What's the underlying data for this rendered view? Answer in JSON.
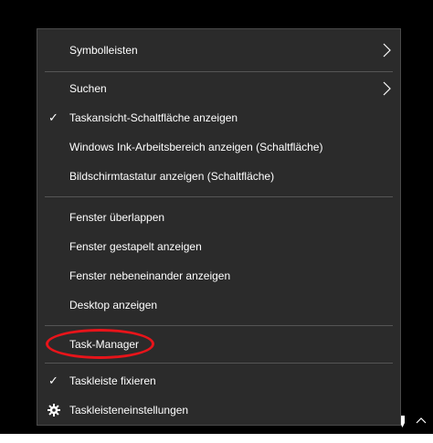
{
  "context_menu": {
    "items": {
      "toolbars": {
        "label": "Symbolleisten",
        "checked": false,
        "submenu": true
      },
      "search": {
        "label": "Suchen",
        "checked": false,
        "submenu": true
      },
      "task_view": {
        "label": "Taskansicht-Schaltfläche anzeigen",
        "checked": true
      },
      "ink_workspace": {
        "label": "Windows Ink-Arbeitsbereich anzeigen (Schaltfläche)",
        "checked": false
      },
      "touch_keyboard": {
        "label": "Bildschirmtastatur anzeigen (Schaltfläche)",
        "checked": false
      },
      "cascade": {
        "label": "Fenster überlappen"
      },
      "stacked": {
        "label": "Fenster gestapelt anzeigen"
      },
      "side_by_side": {
        "label": "Fenster nebeneinander anzeigen"
      },
      "show_desktop": {
        "label": "Desktop anzeigen"
      },
      "task_manager": {
        "label": "Task-Manager",
        "annotated": true
      },
      "lock_taskbar": {
        "label": "Taskleiste fixieren",
        "checked": true
      },
      "taskbar_settings": {
        "label": "Taskleisteneinstellungen",
        "icon": "gear-icon"
      }
    }
  },
  "colors": {
    "menu_background": "#2b2b2b",
    "separator": "#555555",
    "annotation": "#e8141a",
    "text": "#ffffff"
  },
  "icons": {
    "check": "✓",
    "chevron": "chevron-right-icon",
    "settings": "gear-icon",
    "tray_pen": "pen-icon",
    "tray_expand": "chevron-up-icon"
  }
}
